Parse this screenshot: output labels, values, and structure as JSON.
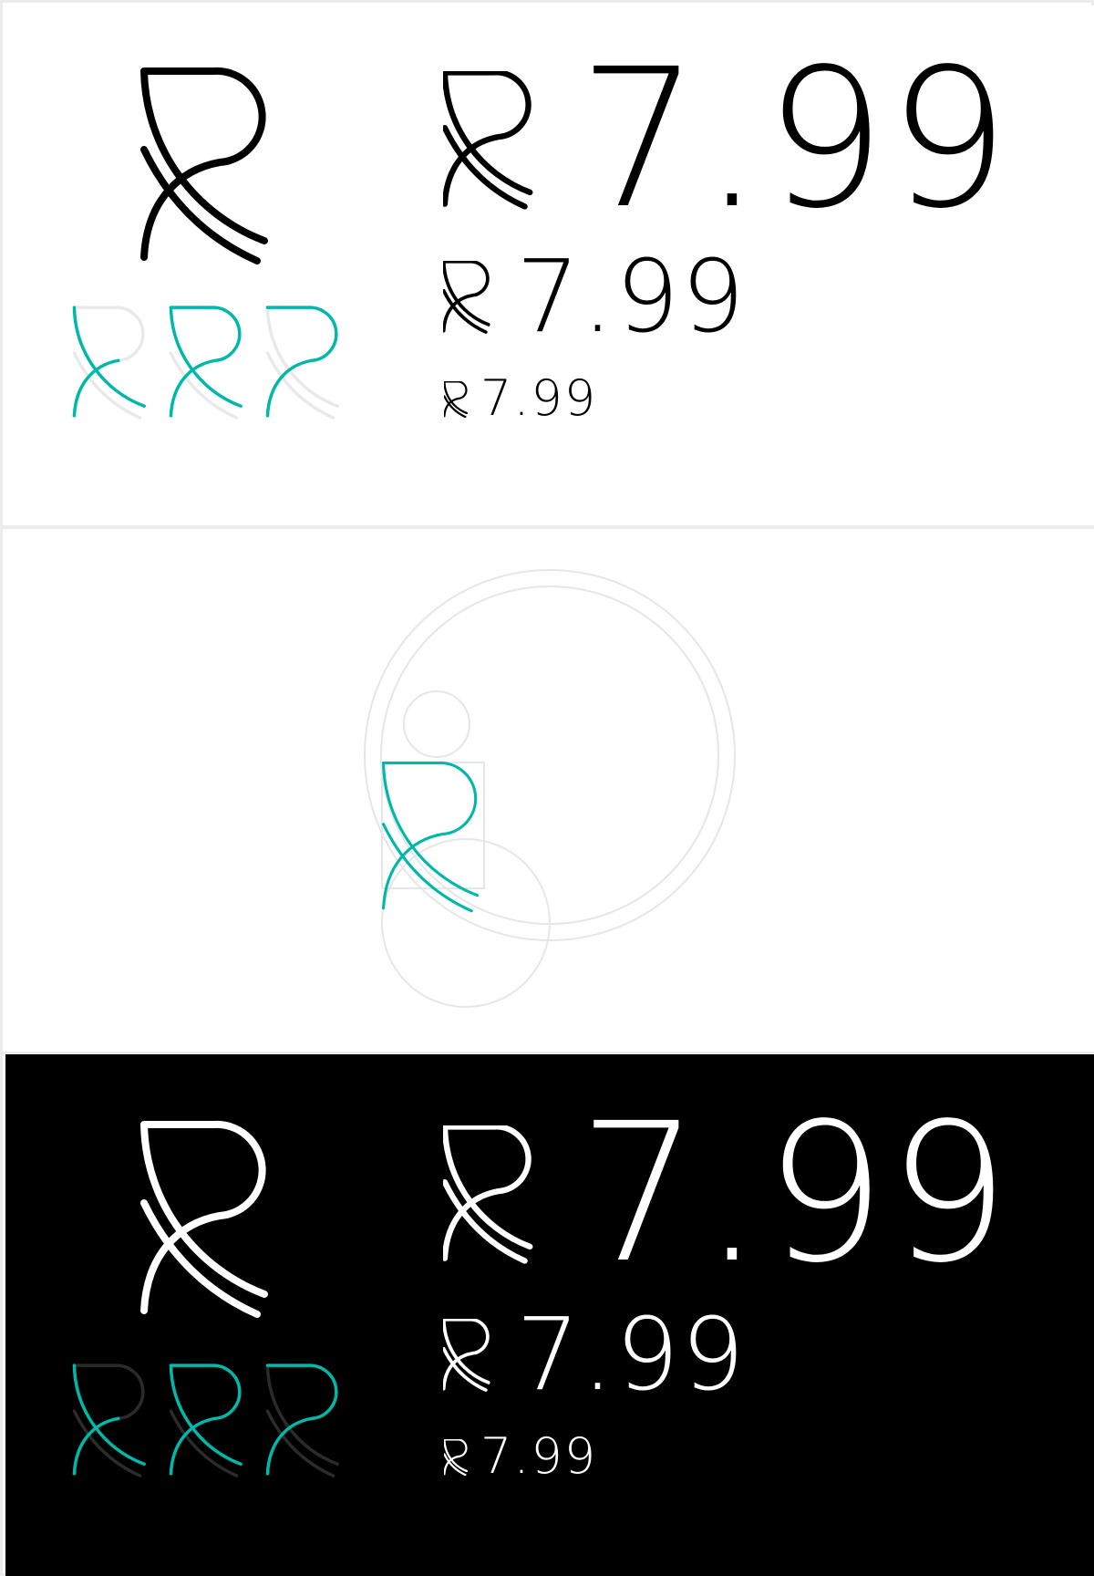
{
  "brand": {
    "symbol_name": "rupee-style-currency-mark",
    "price_text": "7.99",
    "colors": {
      "ink": "#000000",
      "paper": "#ffffff",
      "accent": "#00b8a9",
      "ghost_light": "#e9e9e9",
      "ghost_dark": "#2b2b2b",
      "rule": "#ececec"
    }
  },
  "panels": [
    {
      "id": "light",
      "background": "#ffffff",
      "price_sizes": [
        "large",
        "medium",
        "small"
      ]
    },
    {
      "id": "construction",
      "background": "#ffffff"
    },
    {
      "id": "dark",
      "background": "#000000",
      "price_sizes": [
        "large",
        "medium",
        "small"
      ]
    }
  ],
  "icons": {
    "mark": "currency-symbol-icon",
    "stroke_variants": [
      "stroke-variant-1-icon",
      "stroke-variant-2-icon",
      "stroke-variant-3-icon"
    ]
  }
}
